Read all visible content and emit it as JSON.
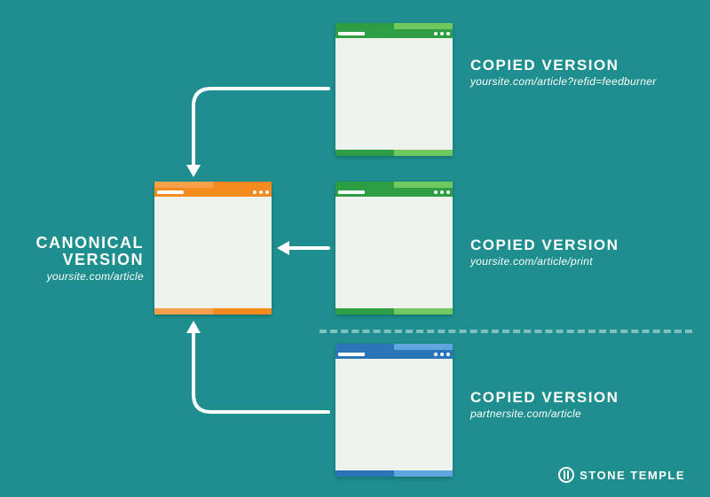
{
  "canonical": {
    "title": "CANONICAL\nVERSION",
    "url": "yoursite.com/article"
  },
  "copies": [
    {
      "title": "COPIED VERSION",
      "url": "yoursite.com/article?refid=feedburner",
      "variant": "green"
    },
    {
      "title": "COPIED VERSION",
      "url": "yoursite.com/article/print",
      "variant": "green"
    },
    {
      "title": "COPIED VERSION",
      "url": "partnersite.com/article",
      "variant": "blue"
    }
  ],
  "brand": "STONE TEMPLE"
}
